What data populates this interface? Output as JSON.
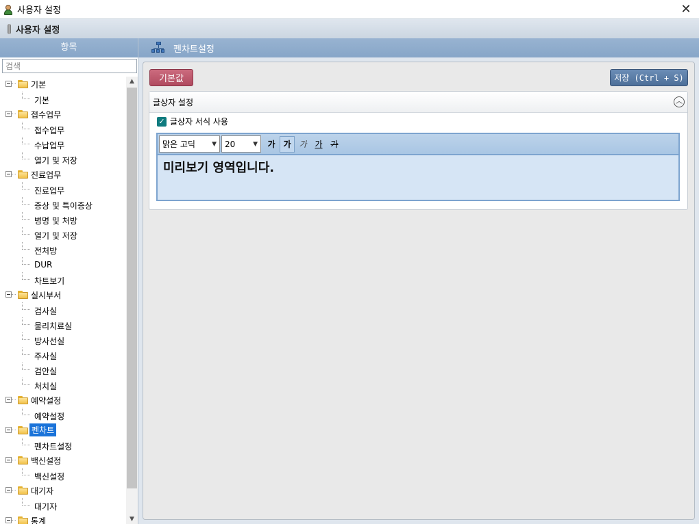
{
  "window": {
    "title": "사용자 설정",
    "close_glyph": "✕"
  },
  "header": {
    "label": "사용자 설정"
  },
  "sidebar": {
    "heading": "항목",
    "search_placeholder": "검색",
    "groups": [
      {
        "label": "기본",
        "items": [
          "기본"
        ]
      },
      {
        "label": "접수업무",
        "items": [
          "접수업무",
          "수납업무",
          "열기 및 저장"
        ]
      },
      {
        "label": "진료업무",
        "items": [
          "진료업무",
          "증상 및 특이증상",
          "병명 및 처방",
          "열기 및 저장",
          "전처방",
          "DUR",
          "차트보기"
        ]
      },
      {
        "label": "실시부서",
        "items": [
          "검사실",
          "물리치료실",
          "방사선실",
          "주사실",
          "검안실",
          "처치실"
        ]
      },
      {
        "label": "예약설정",
        "items": [
          "예약설정"
        ]
      },
      {
        "label": "펜차트",
        "items": [
          "펜차트설정"
        ],
        "selected": true
      },
      {
        "label": "백신설정",
        "items": [
          "백신설정"
        ]
      },
      {
        "label": "대기자",
        "items": [
          "대기자"
        ]
      },
      {
        "label": "통계",
        "items": []
      }
    ]
  },
  "content": {
    "heading": "펜차트설정",
    "default_button": "기본값",
    "save_button": "저장 (Ctrl + S)",
    "panel_title": "글상자 설정",
    "checkbox_label": "글상자 서식 사용",
    "checkbox_checked": true,
    "font_select": "맑은 고딕",
    "size_select": "20",
    "format_buttons": [
      "가",
      "가",
      "가",
      "가",
      "가"
    ],
    "preview_text": "미리보기 영역입니다."
  },
  "colors": {
    "header_blue": "#8fadcf",
    "default_button": "#bd576c",
    "save_button": "#5a7ca6",
    "selected_tree_item": "#1a73d9",
    "checkbox": "#0f7b7f"
  }
}
